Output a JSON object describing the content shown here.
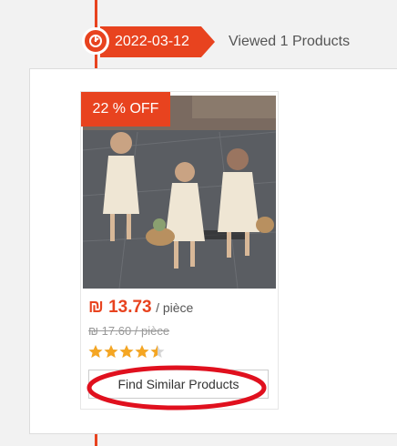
{
  "timeline": {
    "date": "2022-03-12",
    "viewed_text": "Viewed 1 Products"
  },
  "product": {
    "discount_badge": "22 % OFF",
    "price": "₪ 13.73",
    "price_unit": "/ pièce",
    "original_price": "₪ 17.60 / pièce",
    "rating_stars": 4.5,
    "find_similar_label": "Find Similar Products"
  },
  "colors": {
    "accent": "#e8431f",
    "star": "#f5a623",
    "annotation": "#e0101e"
  },
  "icons": {
    "date": "clock-icon",
    "rating": "star-icon"
  }
}
